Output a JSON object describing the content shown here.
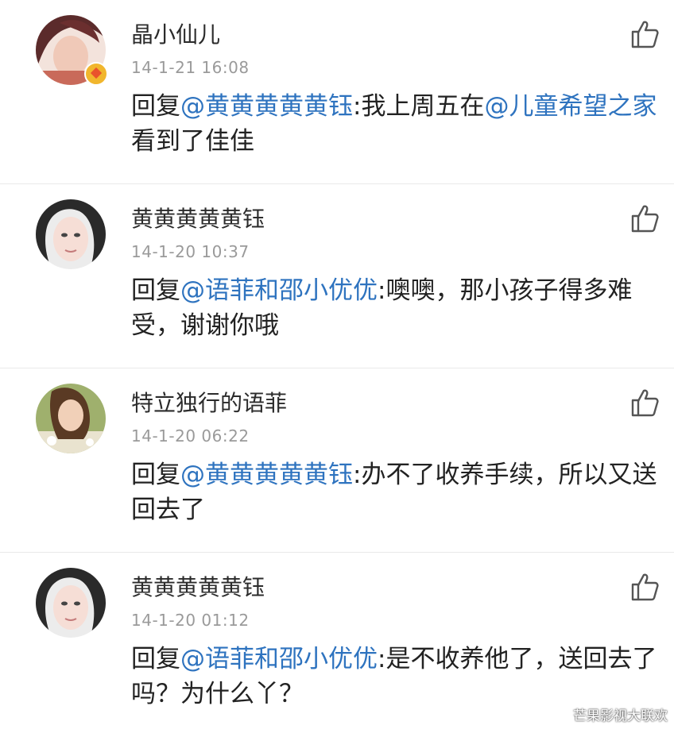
{
  "comments": [
    {
      "username": "晶小仙儿",
      "timestamp": "14-1-21 16:08",
      "reply_prefix": "回复",
      "mention": "@黄黄黄黄黄钰",
      "text_a": ":我上周五在",
      "mention2": "@儿童希望之家",
      "text_b": " 看到了佳佳",
      "avatar_icon": "user-avatar",
      "has_badge": true
    },
    {
      "username": "黄黄黄黄黄钰",
      "timestamp": "14-1-20 10:37",
      "reply_prefix": "回复",
      "mention": "@语菲和邵小优优",
      "text_a": ":噢噢，那小孩子得多难受，谢谢你哦"
    },
    {
      "username": "特立独行的语菲",
      "timestamp": "14-1-20 06:22",
      "reply_prefix": "回复",
      "mention": "@黄黄黄黄黄钰",
      "text_a": ":办不了收养手续，所以又送回去了"
    },
    {
      "username": "黄黄黄黄黄钰",
      "timestamp": "14-1-20 01:12",
      "reply_prefix": "回复",
      "mention": "@语菲和邵小优优",
      "text_a": ":是不收养他了，送回去了吗？为什么丫？"
    }
  ],
  "like_icon": "thumbs-up-icon",
  "watermark": "芒果影视大联欢",
  "colors": {
    "mention": "#2e73bf",
    "text": "#222222",
    "timestamp": "#9a9a9a",
    "divider": "#e9e9e9"
  }
}
